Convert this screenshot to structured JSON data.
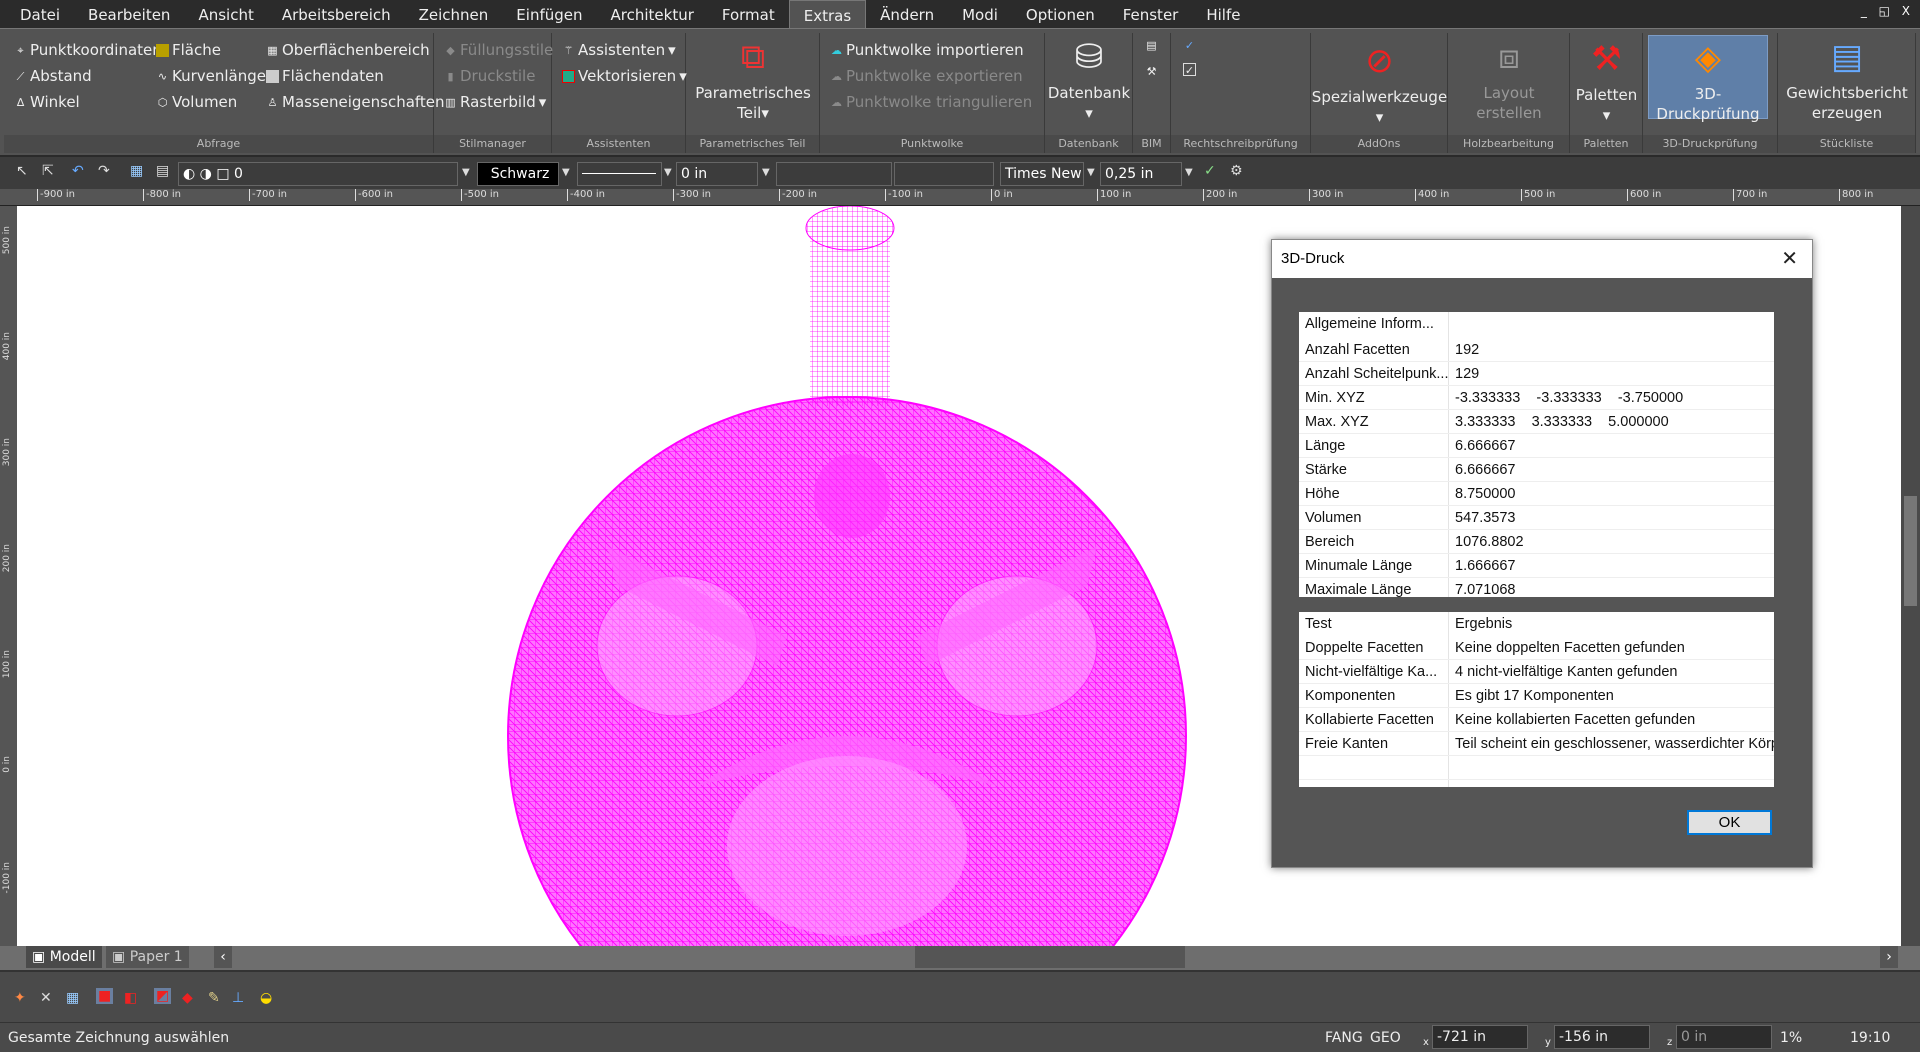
{
  "menu": [
    "Datei",
    "Bearbeiten",
    "Ansicht",
    "Arbeitsbereich",
    "Zeichnen",
    "Einfügen",
    "Architektur",
    "Format",
    "Extras",
    "Ändern",
    "Modi",
    "Optionen",
    "Fenster",
    "Hilfe"
  ],
  "active_menu": "Extras",
  "window_controls": "_ ◱ X",
  "ribbon": {
    "abfrage": {
      "label": "Abfrage",
      "items": [
        "Punktkoordinaten",
        "Abstand",
        "Winkel",
        "Fläche",
        "Kurvenlänge",
        "Volumen",
        "Oberflächenbereich",
        "Flächendaten",
        "Masseneigenschaften"
      ]
    },
    "stilmanager": {
      "label": "Stilmanager",
      "items": [
        "Füllungsstile",
        "Druckstile",
        "Rasterbild"
      ]
    },
    "assistenten": {
      "label": "Assistenten",
      "items": [
        "Assistenten",
        "Vektorisieren"
      ]
    },
    "param": {
      "label": "Parametrisches Teil",
      "button1": "Parametrisches",
      "button2": "Teil"
    },
    "punktwolke": {
      "label": "Punktwolke",
      "items": [
        "Punktwolke importieren",
        "Punktwolke exportieren",
        "Punktwolke triangulieren"
      ]
    },
    "datenbank": {
      "label": "Datenbank",
      "button": "Datenbank"
    },
    "bim": {
      "label": "BIM"
    },
    "rechtschreib": {
      "label": "Rechtschreibprüfung"
    },
    "addons": {
      "label": "AddOns",
      "button": "Spezialwerkzeuge"
    },
    "holz": {
      "label": "Holzbearbeitung",
      "button1": "Layout",
      "button2": "erstellen"
    },
    "paletten": {
      "label": "Paletten",
      "button": "Paletten"
    },
    "druck": {
      "label": "3D-Druckprüfung",
      "button": "3D-Druckprüfung"
    },
    "stueck": {
      "label": "Stückliste",
      "button1": "Gewichtsbericht",
      "button2": "erzeugen"
    }
  },
  "toolbar": {
    "layer": "0",
    "color": "Schwarz",
    "linewidth": "0 in",
    "font": "Times New",
    "textsize": "0,25 in"
  },
  "ruler": [
    "-900 in",
    "-800 in",
    "-700 in",
    "-600 in",
    "-500 in",
    "-400 in",
    "-300 in",
    "-200 in",
    "-100 in",
    "0 in",
    "100 in",
    "200 in",
    "300 in",
    "400 in",
    "500 in",
    "600 in",
    "700 in",
    "800 in"
  ],
  "vruler": [
    "500 in",
    "400 in",
    "300 in",
    "200 in",
    "100 in",
    "0 in",
    "-100 in"
  ],
  "drawing_color": "#ff00ff",
  "tabs": [
    "Modell",
    "Paper 1"
  ],
  "status": {
    "message": "Gesamte Zeichnung auswählen",
    "fang": "FANG",
    "geo": "GEO",
    "x": "-721 in",
    "y": "-156 in",
    "z": "0 in",
    "x_label": "x",
    "y_label": "y",
    "z_label": "z",
    "zoom": "1%",
    "time": "19:10"
  },
  "dialog": {
    "title": "3D-Druck",
    "info_header": [
      "Allgemeine Inform...",
      ""
    ],
    "info": [
      [
        "Anzahl Facetten",
        "192"
      ],
      [
        "Anzahl Scheitelpunk...",
        "129"
      ],
      [
        "Min. XYZ",
        "-3.333333    -3.333333    -3.750000"
      ],
      [
        "Max. XYZ",
        "3.333333    3.333333    5.000000"
      ],
      [
        "Länge",
        "6.666667"
      ],
      [
        "Stärke",
        "6.666667"
      ],
      [
        "Höhe",
        "8.750000"
      ],
      [
        "Volumen",
        "547.3573"
      ],
      [
        "Bereich",
        "1076.8802"
      ],
      [
        "Minumale Länge",
        "1.666667"
      ],
      [
        "Maximale Länge",
        "7.071068"
      ]
    ],
    "tests_header": [
      "Test",
      "Ergebnis"
    ],
    "tests": [
      [
        "Doppelte Facetten",
        "Keine doppelten Facetten gefunden"
      ],
      [
        "Nicht-vielfältige Ka...",
        "4 nicht-vielfältige Kanten gefunden"
      ],
      [
        "Komponenten",
        "Es gibt 17 Komponenten"
      ],
      [
        "Kollabierte Facetten",
        "Keine kollabierten Facetten gefunden"
      ],
      [
        "Freie Kanten",
        "Teil scheint ein geschlossener, wasserdichter Körper"
      ]
    ],
    "ok": "OK"
  }
}
